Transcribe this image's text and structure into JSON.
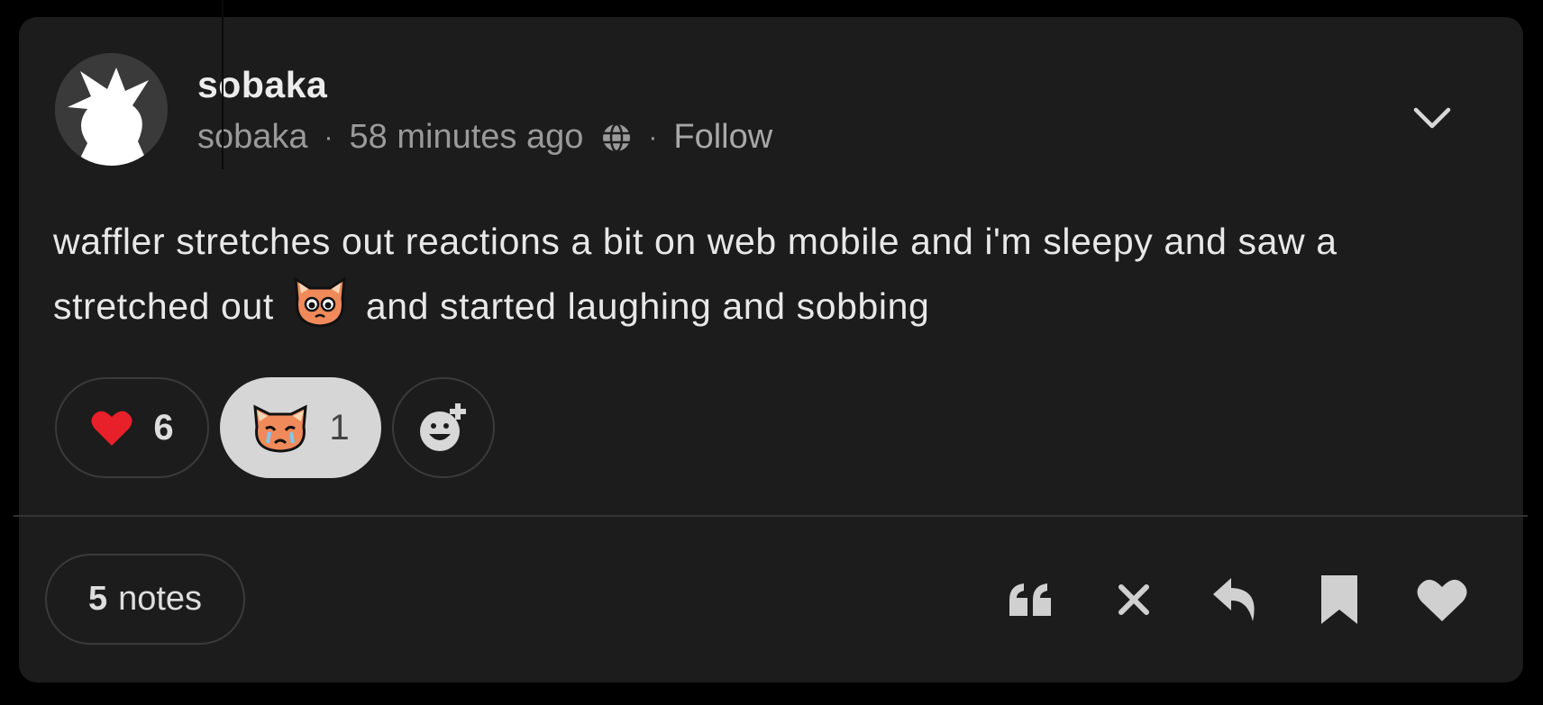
{
  "post": {
    "username": "sobaka",
    "handle": "sobaka",
    "separator": "·",
    "timestamp": "58 minutes ago",
    "visibility_icon": "globe-icon",
    "follow_label": "Follow",
    "menu_icon": "chevron-down-icon",
    "text_part1": "waffler stretches out reactions a bit on web mobile and i'm sleepy and saw a stretched out",
    "text_part2": "and started laughing and sobbing",
    "inline_emoji": "pleading-cat-emoji"
  },
  "reactions": [
    {
      "emoji": "heart-emoji",
      "count": "6",
      "selected": false
    },
    {
      "emoji": "crying-cat-emoji",
      "count": "1",
      "selected": true
    }
  ],
  "add_reaction_icon": "add-reaction-icon",
  "footer": {
    "notes_count": "5",
    "notes_label": "notes",
    "actions": [
      "quote-icon",
      "close-icon",
      "reply-icon",
      "bookmark-icon",
      "like-icon"
    ]
  },
  "colors": {
    "background": "#000000",
    "card": "#1c1c1c",
    "muted_text": "#9a9a9a",
    "heart": "#e8202a",
    "cat_orange": "#f08a5a",
    "selected_reaction": "#d6d6d6"
  }
}
